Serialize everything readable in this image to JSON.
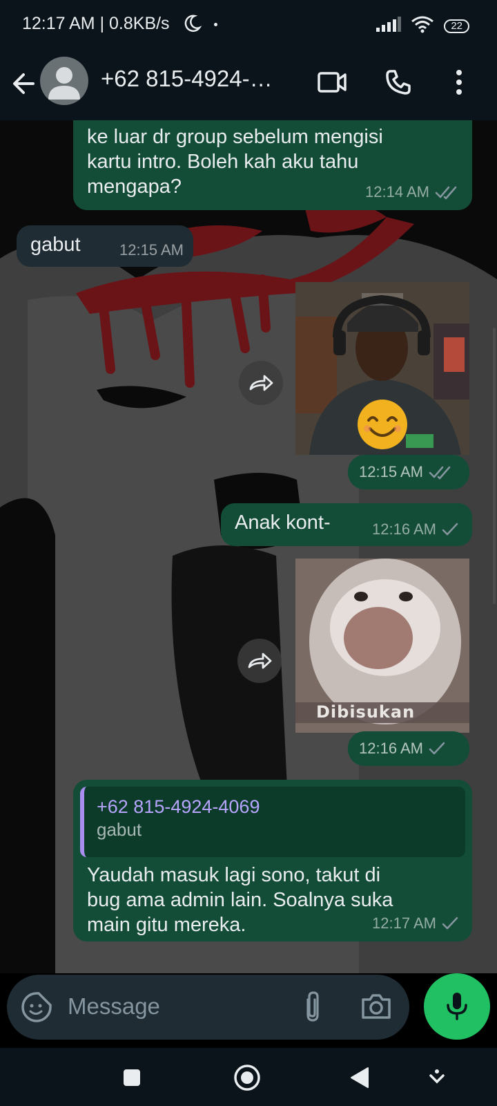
{
  "status_bar": {
    "time_speed": "12:17 AM | 0.8KB/s",
    "battery": "22"
  },
  "header": {
    "contact_name": "+62 815-4924-…",
    "icons": [
      "back-arrow-icon",
      "avatar-icon",
      "video-call-icon",
      "phone-icon",
      "more-vert-icon"
    ]
  },
  "messages": [
    {
      "type": "text",
      "direction": "outgoing",
      "lines": [
        "ke luar dr group sebelum mengisi",
        "kartu intro. Boleh kah aku tahu",
        "mengapa?"
      ],
      "time": "12:14 AM",
      "status": "read"
    },
    {
      "type": "text",
      "direction": "incoming",
      "text": "gabut",
      "time": "12:15 AM"
    },
    {
      "type": "image",
      "direction": "outgoing",
      "media": "man-with-headset-and-smile-emoji",
      "time": "12:15 AM",
      "status": "read"
    },
    {
      "type": "text",
      "direction": "outgoing",
      "text": "Anak kont-",
      "time": "12:16 AM",
      "status": "sent"
    },
    {
      "type": "image",
      "direction": "outgoing",
      "media": "blurry-cat-meme",
      "caption_overlay": "Dibisukan",
      "time": "12:16 AM",
      "status": "sent"
    },
    {
      "type": "reply",
      "direction": "outgoing",
      "quote": {
        "author": "+62 815-4924-4069",
        "text": "gabut"
      },
      "lines": [
        "Yaudah masuk lagi sono, takut di",
        "bug ama admin lain. Soalnya suka",
        "main gitu mereka."
      ],
      "time": "12:17 AM",
      "status": "sent"
    }
  ],
  "composer": {
    "placeholder": "Message",
    "icons": [
      "emoji-sticker-icon",
      "attach-icon",
      "camera-icon",
      "mic-icon"
    ]
  },
  "colors": {
    "outgoing_bubble": "#144d37",
    "incoming_bubble": "#202c33",
    "accent": "#21c063",
    "read_tick": "#8696a0",
    "quote_bar": "#a98ef0"
  }
}
